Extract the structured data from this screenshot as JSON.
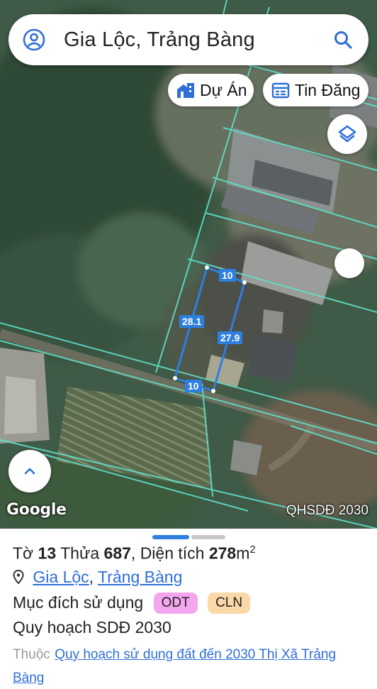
{
  "search": {
    "query": "Gia Lộc, Trảng Bàng"
  },
  "chips": {
    "project_label": "Dự Án",
    "listing_label": "Tin Đăng"
  },
  "map": {
    "provider": "Google",
    "layer_label": "QHSDĐ 2030",
    "parcel_dimensions": {
      "top": "10",
      "left": "28.1",
      "right": "27.9",
      "bottom": "10"
    }
  },
  "sheet": {
    "to_label": "Tờ",
    "to_value": "13",
    "thua_label": "Thửa",
    "thua_value": "687",
    "area_label": "Diện tích",
    "area_value": "278",
    "area_unit": "m",
    "area_exp": "2",
    "ward": "Gia Lộc",
    "district": "Trảng Bàng",
    "sep": ",",
    "usage_label": "Mục đích sử dụng",
    "usage_tags": [
      "ODT",
      "CLN"
    ],
    "plan_label": "Quy hoạch SDĐ 2030",
    "belongs_label": "Thuộc",
    "belongs_link": "Quy hoạch sử dụng đất đến 2030 Thị Xã Trảng Bàng"
  },
  "colors": {
    "accent": "#2f6fd6",
    "parcel_outline": "#2e7fe0",
    "plan_lines": "#5fe0c8",
    "tag_odt_bg": "#f3a6ee",
    "tag_cln_bg": "#fbd8a8",
    "pager_active": "#2e7fe0",
    "pager_inactive": "#c8c8c8"
  },
  "icons": [
    "account-circle-icon",
    "search-icon",
    "building-icon",
    "calendar-list-icon",
    "layers-icon",
    "chevron-up-icon",
    "location-pin-icon"
  ]
}
